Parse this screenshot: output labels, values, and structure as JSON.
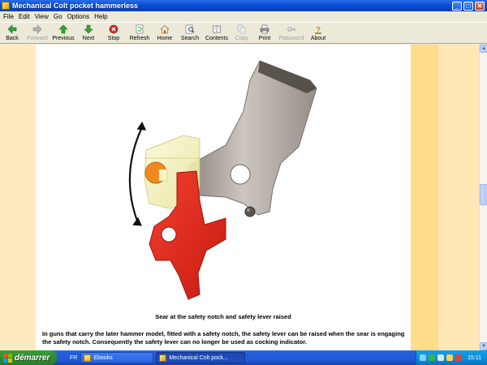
{
  "window": {
    "title": "Mechanical Colt pocket hammerless"
  },
  "menu": [
    "File",
    "Edit",
    "View",
    "Go",
    "Options",
    "Help"
  ],
  "toolbar": {
    "back": "Back",
    "forward": "Forward",
    "previous": "Previous",
    "next": "Next",
    "stop": "Stop",
    "refresh": "Refresh",
    "home": "Home",
    "search": "Search",
    "contents": "Contents",
    "copy": "Copy",
    "print": "Print",
    "password": "Password",
    "about": "About"
  },
  "content": {
    "caption": "Sear at the safety notch and safety lever raised",
    "paragraph": "In guns that carry the later hammer model, fitted with a safety notch, the safety lever can be raised when the sear is engaging the safety notch. Consequently the safety lever can no longer be used as cocking indicator."
  },
  "taskbar": {
    "start": "démarrer",
    "language": "FR",
    "tasks": [
      "Ebooks",
      "Mechanical Colt pock..."
    ],
    "clock": "15:11"
  },
  "colors": {
    "titlebar": "#0a4fd8",
    "taskbar": "#245ddb",
    "start": "#2f8a2f",
    "page_bg": "#ffffff",
    "band_light": "#ffe7b6",
    "band_dark": "#ffdc8a",
    "sear_red": "#e02515",
    "hammer_grey": "#a49b94",
    "safety_yellow": "#f4f2b8"
  }
}
